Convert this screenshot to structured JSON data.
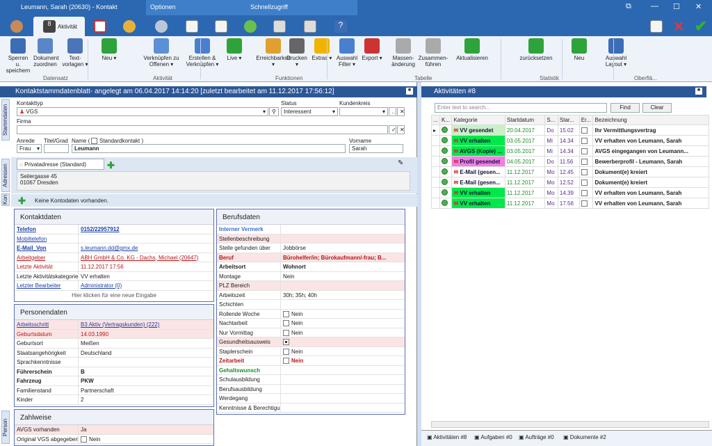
{
  "window": {
    "title": "Leumann, Sarah (20630) - Kontakt",
    "tab_options": "Optionen",
    "tab_quick": "Schnellzugriff",
    "active_tab": "Aktivität"
  },
  "ribbon": {
    "buttons": [
      {
        "id": "sperren",
        "label": "Sperren u. speichern",
        "icon_color": "#3d6db5"
      },
      {
        "id": "dokument",
        "label": "Dokument zuordnen",
        "icon_color": "#5a86c5"
      },
      {
        "id": "textvorlagen",
        "label": "Text- vorlagen ▾",
        "icon_color": "#4b75b8"
      },
      {
        "id": "neu",
        "label": "Neu ▾",
        "icon_color": "#2fa33b"
      },
      {
        "id": "verknuepfen",
        "label": "Verknüpfen zu Offenen ▾",
        "icon_color": "#5b8fd6"
      },
      {
        "id": "erstellen",
        "label": "Erstellen & Verknüpfen ▾",
        "icon_color": "#4a7fcf"
      },
      {
        "id": "live",
        "label": "Live ▾",
        "icon_color": "#2fa33b"
      },
      {
        "id": "erreichbarkeit",
        "label": "Erreichbarkeit ▾",
        "icon_color": "#e0a030"
      },
      {
        "id": "drucken",
        "label": "Drucken ▾",
        "icon_color": "#666666"
      },
      {
        "id": "extras",
        "label": "Extras ▾",
        "icon_color": "#f0b400"
      },
      {
        "id": "auswahlfilter",
        "label": "Auswahl Filter ▾",
        "icon_color": "#4a7fcf"
      },
      {
        "id": "export",
        "label": "Export ▾",
        "icon_color": "#c33"
      },
      {
        "id": "massen",
        "label": "Massen- änderung",
        "icon_color": "#aaaaaa"
      },
      {
        "id": "zusammen",
        "label": "Zusammen- führen",
        "icon_color": "#aaaaaa"
      },
      {
        "id": "aktualisieren",
        "label": "Aktualisieren",
        "icon_color": "#2fa33b"
      },
      {
        "id": "zuruecksetzen",
        "label": "zurücksetzen",
        "icon_color": "#2fa33b"
      },
      {
        "id": "neu2",
        "label": "Neu",
        "icon_color": "#2fa33b"
      },
      {
        "id": "layout",
        "label": "Auswahl Layout ▾",
        "icon_color": "#3d6db5"
      }
    ],
    "groups": [
      "Datensatz",
      "Aktivität",
      "Funktionen",
      "Tabelle",
      "Statistik",
      "Oberflä..."
    ]
  },
  "left": {
    "header": "Kontaktstammdatenblatt- angelegt am 06.04.2017 14:14:20 [zuletzt bearbeitet am 11.12.2017 17:56:12]",
    "side_tabs": {
      "stamm": "Stammdaten",
      "adressen": "Adressen",
      "kon": "Kon",
      "person": "Person"
    },
    "kontakttyp_label": "Kontakttyp",
    "kontakttyp": "VGS",
    "status_label": "Status",
    "status": "Interessent",
    "kundenkreis_label": "Kundenkreis",
    "firma_label": "Firma",
    "anrede_label": "Anrede",
    "anrede": "Frau",
    "titel_label": "Titel/Grad",
    "name_label": "Name (",
    "standard_label": "Standardkontakt )",
    "name": "Leumann",
    "vorname_label": "Vorname",
    "vorname": "Sarah",
    "address_tab": "Privatadresse (Standard)",
    "street": "Seilergasse 45",
    "city": "01067 Dresden",
    "no_accounts": "Keine Kontodaten vorhanden."
  },
  "kontaktdaten": {
    "title": "Kontaktdaten",
    "rows": [
      {
        "k": "Telefon",
        "v": "0152/22957912",
        "kc": "link bold",
        "vc": "link bold"
      },
      {
        "k": "Mobiltelefon",
        "v": "",
        "kc": "link",
        "vc": ""
      },
      {
        "k": "E-Mail_Von",
        "v": "s.leumann.dd@gmx.de",
        "kc": "link bold",
        "vc": "link"
      },
      {
        "k": "Arbeitgeber",
        "v": "ABH GmbH & Co. KG - Dachs, Michael (20647)",
        "kc": "link red",
        "vc": "link red"
      },
      {
        "k": "Letzte Aktivität",
        "v": "11.12.2017 17:56",
        "kc": "red",
        "vc": "red"
      },
      {
        "k": "Letzte Aktivitätskategorie",
        "v": "VV erhalten",
        "kc": "",
        "vc": ""
      },
      {
        "k": "Letzter Bearbeiter",
        "v": "Administrator (0)",
        "kc": "link",
        "vc": "link"
      }
    ],
    "footer": "Hier klicken für eine neue Eingabe"
  },
  "personendaten": {
    "title": "Personendaten",
    "rows": [
      {
        "k": "Arbeitsschritt",
        "v": "B3 Aktiv (Vertragskunden) (222)",
        "kc": "link",
        "vc": "link",
        "pink": true
      },
      {
        "k": "Geburtsdatum",
        "v": "14.03.1990",
        "kc": "red",
        "vc": "red",
        "pink": true
      },
      {
        "k": "Geburtsort",
        "v": "Meißen",
        "kc": "",
        "vc": ""
      },
      {
        "k": "Staatsangehörigkeit",
        "v": "Deutschland",
        "kc": "",
        "vc": ""
      },
      {
        "k": "Sprachkenntnisse",
        "v": "",
        "kc": "",
        "vc": ""
      },
      {
        "k": "Führerschein",
        "v": "B",
        "kc": "bold",
        "vc": "bold"
      },
      {
        "k": "Fahrzeug",
        "v": "PKW",
        "kc": "bold",
        "vc": "bold"
      },
      {
        "k": "Familienstand",
        "v": "Partnerschaft",
        "kc": "",
        "vc": ""
      },
      {
        "k": "Kinder",
        "v": "2",
        "kc": "",
        "vc": ""
      }
    ]
  },
  "zahlweise": {
    "title": "Zahlweise",
    "rows": [
      {
        "k": "AVGS vorhanden",
        "v": "Ja",
        "kc": "",
        "vc": "",
        "pink": true
      },
      {
        "k": "Original VGS abgegeben",
        "v": "Nein",
        "kc": "",
        "vc": "",
        "cb": true
      }
    ]
  },
  "berufsdaten": {
    "title": "Berufsdaten",
    "rows": [
      {
        "k": "Interner Vermerk",
        "v": "",
        "kc": "bold",
        "vc": "",
        "blue": true
      },
      {
        "k": "Stellenbeschreibung",
        "v": "",
        "kc": "",
        "vc": "",
        "pink": true
      },
      {
        "k": "Stelle gefunden über",
        "v": "Jobbörse",
        "kc": "",
        "vc": ""
      },
      {
        "k": "Beruf",
        "v": "Bürohelfer/in; Bürokaufmann/-frau; B...",
        "kc": "red bold",
        "vc": "red bold",
        "pink": true
      },
      {
        "k": "Arbeitsort",
        "v": "Wohnort",
        "kc": "bold",
        "vc": "bold"
      },
      {
        "k": "Montage",
        "v": "Nein",
        "kc": "",
        "vc": ""
      },
      {
        "k": "PLZ Bereich",
        "v": "",
        "kc": "",
        "vc": "",
        "pink": true
      },
      {
        "k": "Arbeitszeit",
        "v": "30h; 35h; 40h",
        "kc": "",
        "vc": ""
      },
      {
        "k": "Schichten",
        "v": "",
        "kc": "",
        "vc": ""
      },
      {
        "k": "Rollende Woche",
        "v": "Nein",
        "kc": "",
        "vc": "",
        "cb": true
      },
      {
        "k": "Nachtarbeit",
        "v": "Nein",
        "kc": "",
        "vc": "",
        "cb": true
      },
      {
        "k": "Nur Vormittag",
        "v": "Nein",
        "kc": "",
        "vc": "",
        "cb": true
      },
      {
        "k": "Gesundheitsausweis",
        "v": "",
        "kc": "",
        "vc": "",
        "cbon": true,
        "pink": true
      },
      {
        "k": "Staplerschein",
        "v": "Nein",
        "kc": "",
        "vc": "",
        "cb": true
      },
      {
        "k": "Zeitarbeit",
        "v": "Nein",
        "kc": "red bold",
        "vc": "red bold",
        "cb": true
      },
      {
        "k": "Gehaltswunsch",
        "v": "",
        "kc": "green",
        "vc": ""
      },
      {
        "k": "Schulausbildung",
        "v": "",
        "kc": "",
        "vc": ""
      },
      {
        "k": "Berufsausbildung",
        "v": "",
        "kc": "",
        "vc": ""
      },
      {
        "k": "Werdegang",
        "v": "",
        "kc": "",
        "vc": ""
      },
      {
        "k": "Kenntnisse & Berechtigungen",
        "v": "",
        "kc": "",
        "vc": ""
      }
    ]
  },
  "right": {
    "header": "Aktivitäten #8",
    "search_placeholder": "Enter text to search...",
    "find": "Find",
    "clear": "Clear",
    "columns": [
      "...",
      "K...",
      "Kategorie",
      "Startdatum",
      "S...",
      "Star...",
      "Er...",
      "Bezeichnung"
    ],
    "rows": [
      {
        "kat": "VV gesendet",
        "kbg": "#c9f0c9",
        "date": "20.04.2017",
        "day": "Do",
        "time": "15.02",
        "bez": "Ihr Vermittlungsvertrag",
        "sel": true
      },
      {
        "kat": "VV erhalten",
        "kbg": "#00e84a",
        "date": "03.05.2017",
        "day": "Mi",
        "time": "14.34",
        "bez": "VV erhalten von Leumann, Sarah"
      },
      {
        "kat": "AVGS (Kopie) ...",
        "kbg": "#00e84a",
        "date": "03.05.2017",
        "day": "Mi",
        "time": "14.34",
        "bez": "AVGS eingegangen von Leumann..."
      },
      {
        "kat": "Profil gesendet",
        "kbg": "#f07ee8",
        "date": "04.05.2017",
        "day": "Do",
        "time": "11.56",
        "bez": "Bewerberprofil - Leumann, Sarah"
      },
      {
        "kat": "E-Mail (gesen...",
        "kbg": "#ffffff",
        "date": "11.12.2017",
        "day": "Mo",
        "time": "12.45",
        "bez": "Dokument(e) kreiert"
      },
      {
        "kat": "E-Mail (gesen...",
        "kbg": "#ffffff",
        "date": "11.12.2017",
        "day": "Mo",
        "time": "12.52",
        "bez": "Dokument(e) kreiert"
      },
      {
        "kat": "VV erhalten",
        "kbg": "#00e84a",
        "date": "11.12.2017",
        "day": "Mo",
        "time": "14.39",
        "bez": "VV erhalten von Leumann, Sarah"
      },
      {
        "kat": "VV erhalten",
        "kbg": "#00e84a",
        "date": "11.12.2017",
        "day": "Mo",
        "time": "17.56",
        "bez": "VV erhalten von Leumann, Sarah"
      }
    ],
    "bottom_tabs": [
      "Aktivitäten #8",
      "Aufgaben #0",
      "Aufträge #0",
      "Dokumente #2"
    ]
  }
}
